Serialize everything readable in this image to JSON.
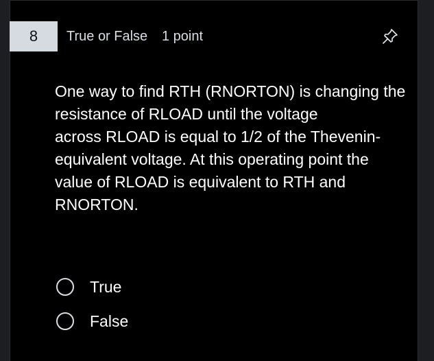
{
  "question": {
    "number": "8",
    "type": "True or False",
    "points": "1 point",
    "pin_icon": "pin-icon",
    "text_lines": [
      "One way to find RTH (RNORTON) is changing the",
      "resistance of RLOAD until the voltage",
      "across RLOAD is equal to 1/2 of the Thevenin-",
      "equivalent voltage. At this operating point the",
      "value of RLOAD is equivalent to RTH and",
      "RNORTON."
    ]
  },
  "options": [
    {
      "label": "True",
      "selected": false
    },
    {
      "label": "False",
      "selected": false
    }
  ],
  "colors": {
    "background": "#000000",
    "number_badge": "#d6dbe2",
    "text": "#ffffff",
    "muted_text": "#d9dde3"
  }
}
